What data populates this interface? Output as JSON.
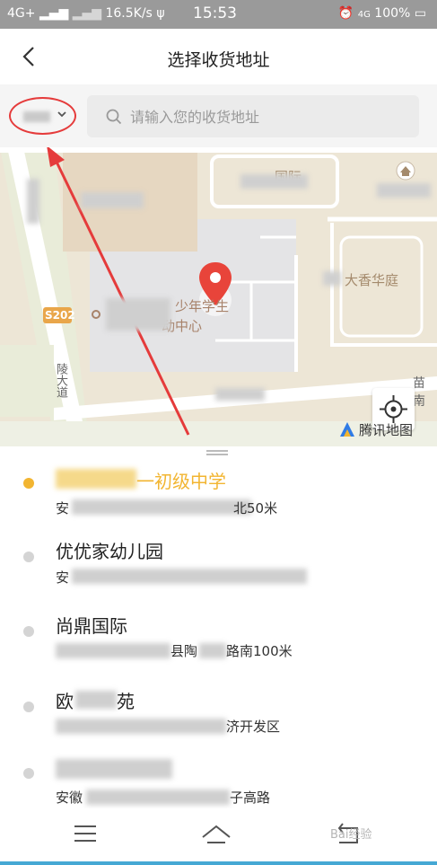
{
  "status_bar": {
    "network_left": "4G+",
    "speed": "16.5K/s",
    "time": "15:53",
    "network_right": "4G",
    "battery": "100%"
  },
  "header": {
    "title": "选择收货地址",
    "back_icon": "chevron-left-icon"
  },
  "search": {
    "placeholder": "请输入您的收货地址",
    "city_chevron_icon": "chevron-down-icon",
    "search_icon": "search-icon"
  },
  "map": {
    "labels": {
      "guoji": "国际",
      "xianghuating": "大香华庭",
      "school_poi_suffix": "少年学生",
      "school_poi_line2": "动中心",
      "road_s202": "S202",
      "road_dadao": "陵大道",
      "road_right": "苗南"
    },
    "brand": "腾讯地图",
    "locate_icon": "crosshair-icon"
  },
  "list": {
    "items": [
      {
        "name": "一初级中学",
        "address": "安",
        "address_tail": "北50米",
        "active": true
      },
      {
        "name": "优优家幼儿园",
        "address": "安",
        "address_tail": "",
        "active": false
      },
      {
        "name": "尚鼎国际",
        "address": "",
        "address_tail": "县陶",
        "address_end": "路南100米",
        "active": false
      },
      {
        "name": "欧",
        "name_tail": "苑",
        "address": "",
        "address_tail": "济开发区",
        "active": false
      },
      {
        "name": "",
        "address": "安徽",
        "address_tail": "子高路",
        "active": false
      }
    ]
  },
  "bottom_nav": {
    "menu_icon": "menu-icon",
    "home_icon": "home-icon",
    "back_icon": "back-icon"
  },
  "watermark": "Bai经验",
  "colors": {
    "accent": "#f2b531",
    "pin": "#e8443a",
    "annotation": "#e53b3b"
  }
}
